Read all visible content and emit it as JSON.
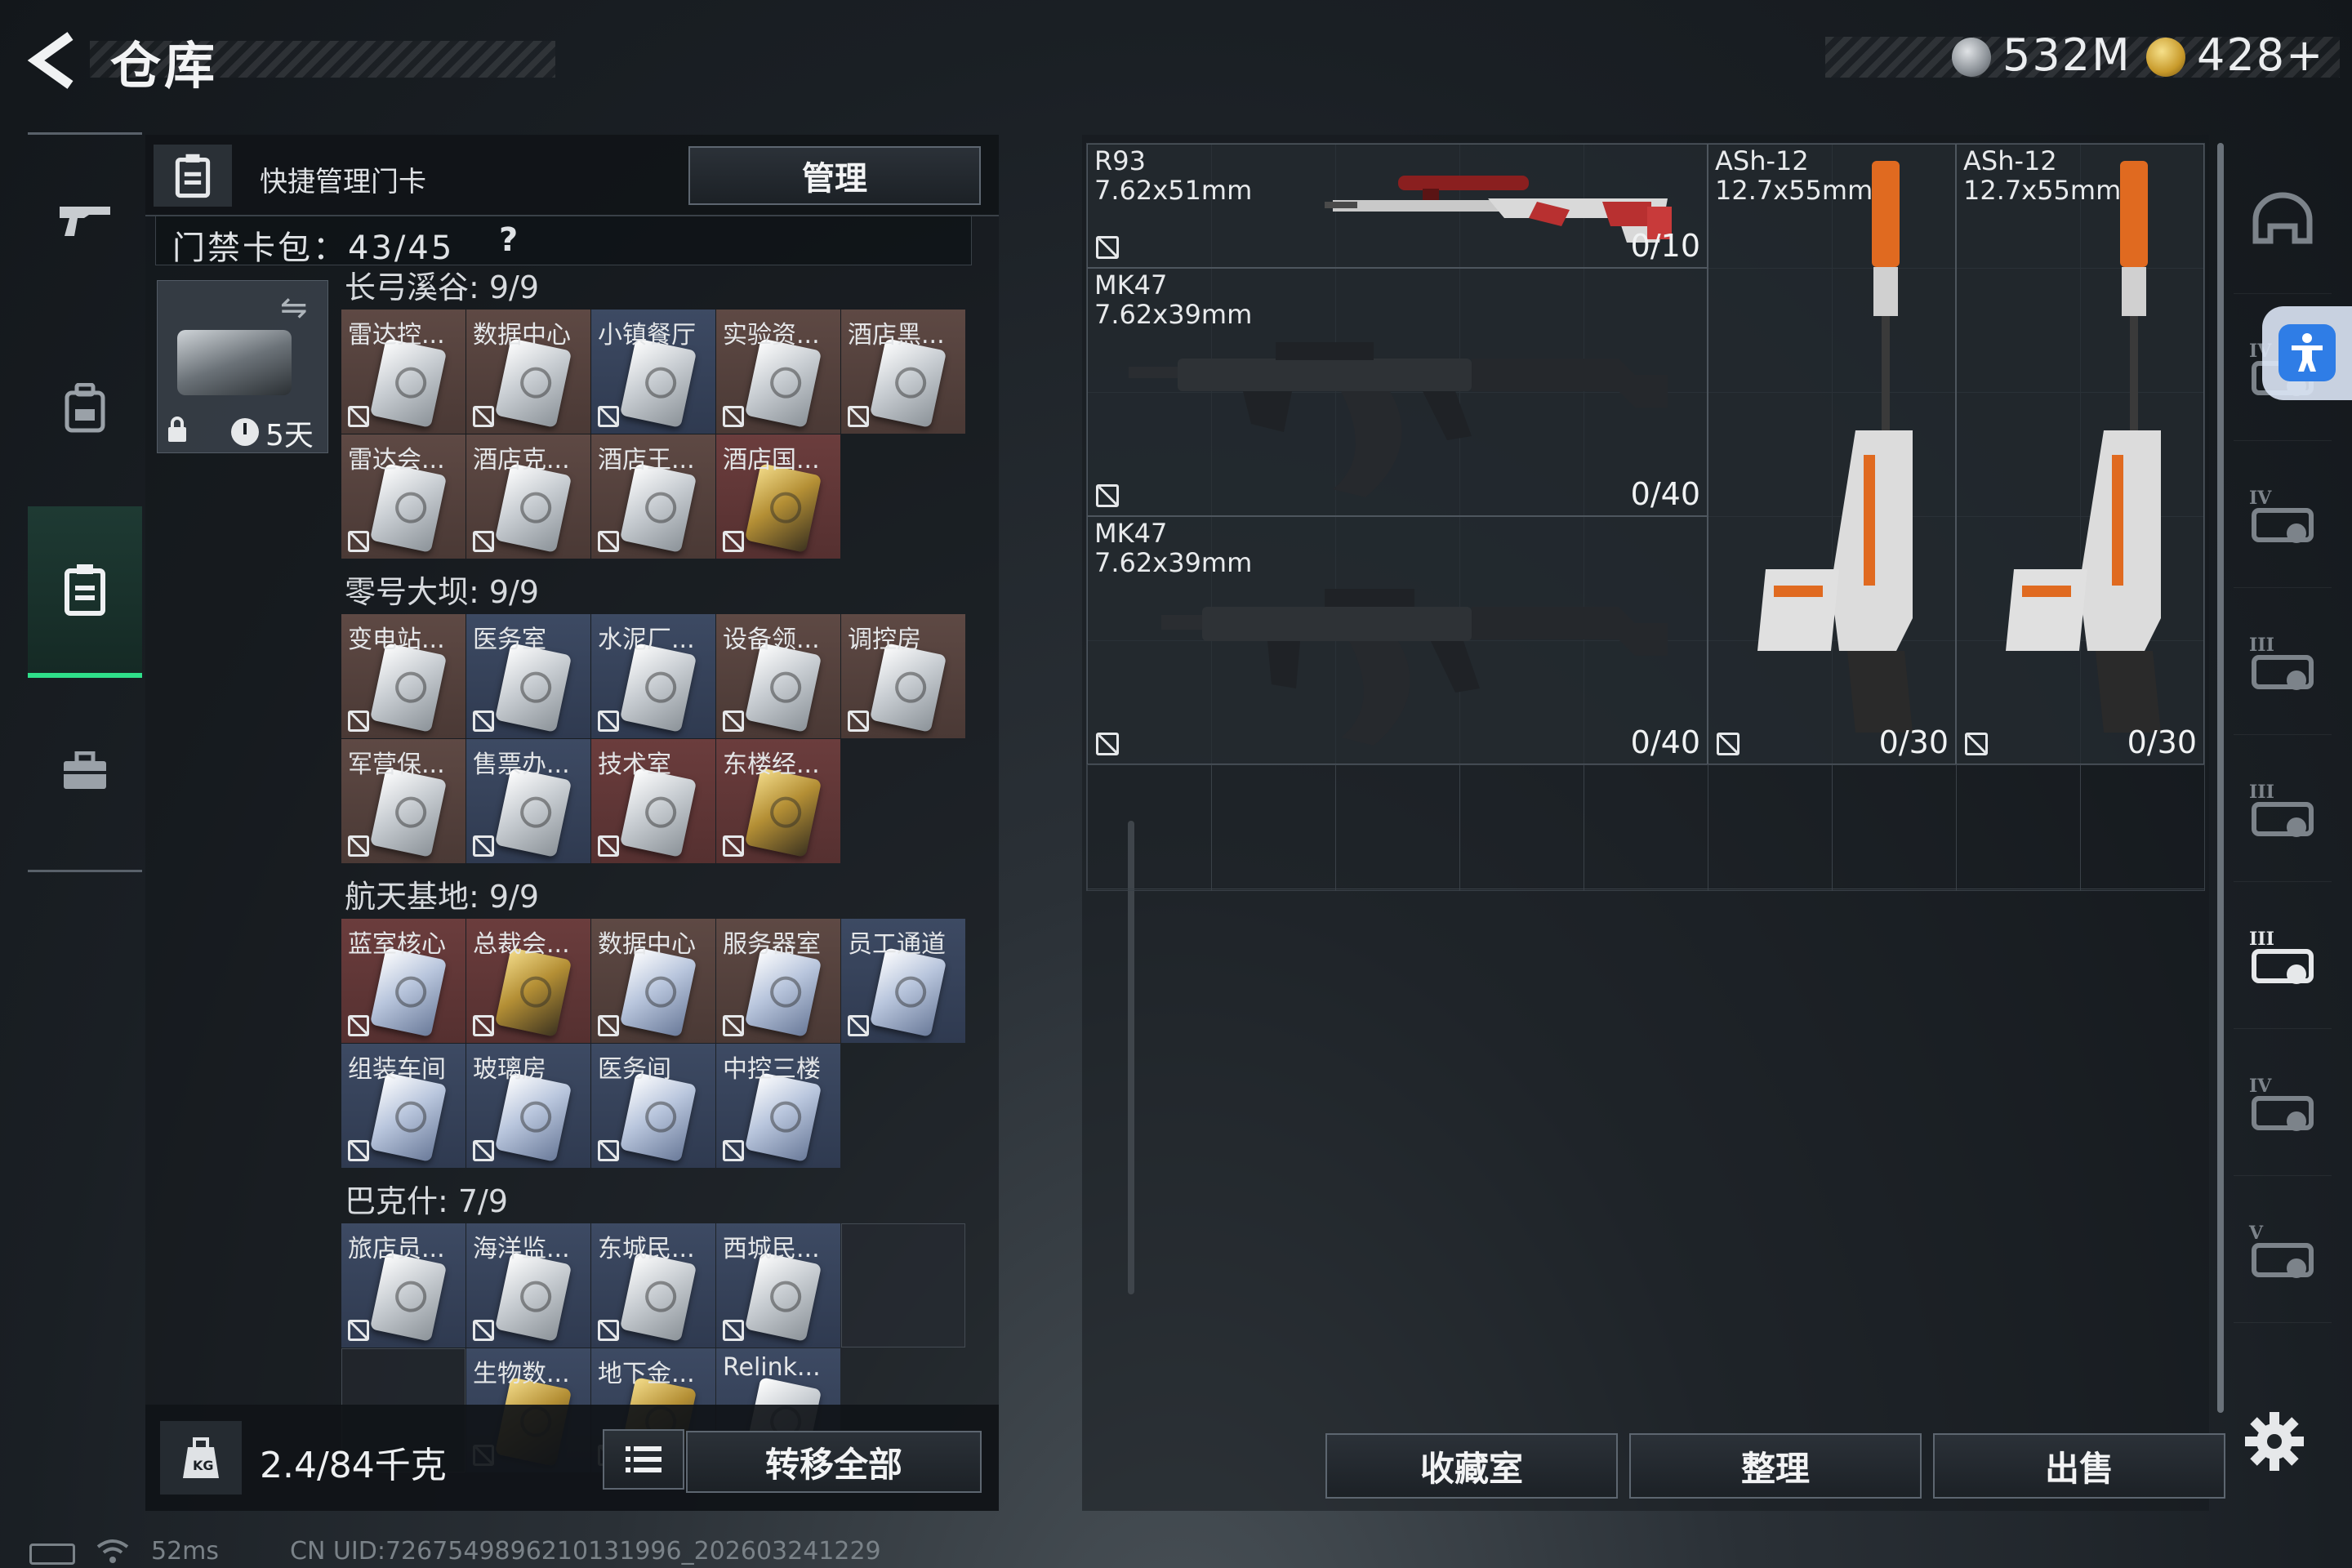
{
  "header": {
    "title": "仓库",
    "currencies": [
      {
        "name": "silver-coin",
        "value": "532M"
      },
      {
        "name": "gold-coin",
        "value": "428+"
      }
    ]
  },
  "left_nav": {
    "items": [
      {
        "name": "weapons",
        "icon": "gun-icon"
      },
      {
        "name": "backpack",
        "icon": "backpack-icon"
      },
      {
        "name": "keycards",
        "icon": "keycard-icon",
        "active": true
      },
      {
        "name": "toolbox",
        "icon": "toolbox-icon"
      }
    ]
  },
  "keycard_panel": {
    "header_label": "快捷管理门卡",
    "manage_label": "管理",
    "bag_label": "门禁卡包：43/45",
    "help": "?",
    "holder_days": "5天",
    "groups": [
      {
        "title": "长弓溪谷: 9/9",
        "tiles": [
          {
            "label": "雷达控...",
            "color": "brown",
            "card": "white"
          },
          {
            "label": "数据中心",
            "color": "brown",
            "card": "white"
          },
          {
            "label": "小镇餐厅",
            "color": "blue",
            "card": "white"
          },
          {
            "label": "实验资...",
            "color": "brown",
            "card": "white"
          },
          {
            "label": "酒店黑...",
            "color": "brown",
            "card": "white"
          },
          {
            "label": "雷达会...",
            "color": "brown",
            "card": "white"
          },
          {
            "label": "酒店克...",
            "color": "brown",
            "card": "white"
          },
          {
            "label": "酒店王...",
            "color": "brown",
            "card": "white"
          },
          {
            "label": "酒店国...",
            "color": "red",
            "card": "gold"
          }
        ]
      },
      {
        "title": "零号大坝: 9/9",
        "tiles": [
          {
            "label": "变电站...",
            "color": "brown",
            "card": "white"
          },
          {
            "label": "医务室",
            "color": "blue",
            "card": "white"
          },
          {
            "label": "水泥厂...",
            "color": "blue",
            "card": "white"
          },
          {
            "label": "设备领...",
            "color": "brown",
            "card": "white"
          },
          {
            "label": "调控房",
            "color": "brown",
            "card": "white"
          },
          {
            "label": "军营保...",
            "color": "brown",
            "card": "white"
          },
          {
            "label": "售票办...",
            "color": "blue",
            "card": "white"
          },
          {
            "label": "技术室",
            "color": "red",
            "card": "white"
          },
          {
            "label": "东楼经...",
            "color": "red",
            "card": "gold"
          }
        ]
      },
      {
        "title": "航天基地: 9/9",
        "tiles": [
          {
            "label": "蓝室核心",
            "color": "red",
            "card": "blueish"
          },
          {
            "label": "总裁会...",
            "color": "red",
            "card": "gold"
          },
          {
            "label": "数据中心",
            "color": "brown",
            "card": "blueish"
          },
          {
            "label": "服务器室",
            "color": "brown",
            "card": "blueish"
          },
          {
            "label": "员工通道",
            "color": "blue",
            "card": "blueish"
          },
          {
            "label": "组装车间",
            "color": "blue",
            "card": "blueish"
          },
          {
            "label": "玻璃房",
            "color": "blue",
            "card": "blueish"
          },
          {
            "label": "医务间",
            "color": "blue",
            "card": "blueish"
          },
          {
            "label": "中控三楼",
            "color": "blue",
            "card": "blueish"
          }
        ]
      },
      {
        "title": "巴克什: 7/9",
        "tiles": [
          {
            "label": "旅店员...",
            "color": "blue",
            "card": "white"
          },
          {
            "label": "海洋监...",
            "color": "blue",
            "card": "white"
          },
          {
            "label": "东城民...",
            "color": "blue",
            "card": "white"
          },
          {
            "label": "西城民...",
            "color": "blue",
            "card": "white"
          },
          {
            "label": "",
            "color": "empty",
            "card": "none"
          },
          {
            "label": "",
            "color": "empty",
            "card": "none"
          },
          {
            "label": "生物数...",
            "color": "blue",
            "card": "gold"
          },
          {
            "label": "地下金...",
            "color": "blue",
            "card": "gold"
          },
          {
            "label": "Relink...",
            "color": "blue",
            "card": "white"
          }
        ]
      }
    ],
    "weight": "2.4/84千克",
    "transfer_label": "转移全部"
  },
  "weapons": [
    {
      "name": "R93",
      "caliber": "7.62x51mm",
      "count": "0/10",
      "accent": "#b83030"
    },
    {
      "name": "MK47",
      "caliber": "7.62x39mm",
      "count": "0/40",
      "accent": "#1f2226"
    },
    {
      "name": "MK47",
      "caliber": "7.62x39mm",
      "count": "0/40",
      "accent": "#1f2226"
    },
    {
      "name": "ASh-12",
      "caliber": "12.7x55mm",
      "count": "0/30",
      "accent": "#e06a20"
    },
    {
      "name": "ASh-12",
      "caliber": "12.7x55mm",
      "count": "0/30",
      "accent": "#e06a20"
    }
  ],
  "right_rail": [
    "helmet-icon",
    "armor-iv-icon",
    "rig-iv-icon",
    "rig-iii-icon",
    "rig-iii-b-icon",
    "gun-case-iii-icon",
    "medkit-iv-icon",
    "case-v-icon"
  ],
  "bottom_buttons": {
    "collection": "收藏室",
    "tidy": "整理",
    "sell": "出售"
  },
  "status": {
    "ping": "52ms",
    "uid": "CN UID:7267549896210131996_202603241229"
  }
}
